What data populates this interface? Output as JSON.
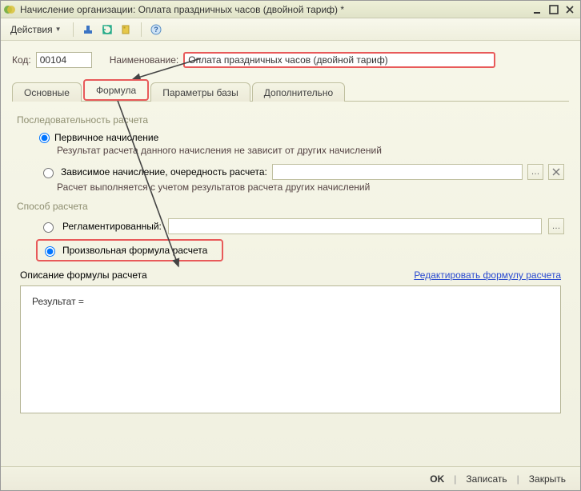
{
  "window": {
    "title": "Начисление организации: Оплата праздничных часов (двойной тариф) *"
  },
  "toolbar": {
    "actions_label": "Действия"
  },
  "header": {
    "code_label": "Код:",
    "code_value": "00104",
    "name_label": "Наименование:",
    "name_value": "Оплата праздничных часов (двойной тариф)"
  },
  "tabs": {
    "main": "Основные",
    "formula": "Формула",
    "params": "Параметры базы",
    "extra": "Дополнительно"
  },
  "sequence": {
    "title": "Последовательность расчета",
    "primary": "Первичное начисление",
    "primary_hint": "Результат расчета данного начисления не зависит от других начислений",
    "dependent": "Зависимое начисление, очередность расчета:",
    "dependent_hint": "Расчет выполняется с учетом результатов расчета других начислений"
  },
  "method": {
    "title": "Способ расчета",
    "regulated": "Регламентированный:",
    "arbitrary": "Произвольная формула расчета"
  },
  "description": {
    "label": "Описание формулы расчета",
    "edit_link": "Редактировать формулу расчета",
    "formula_text": "Результат ="
  },
  "footer": {
    "ok": "OK",
    "write": "Записать",
    "close": "Закрыть"
  }
}
